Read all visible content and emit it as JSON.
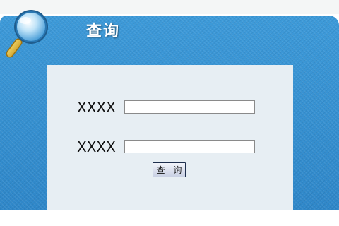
{
  "header": {
    "title": "查询",
    "icon": "magnifier-icon"
  },
  "form": {
    "fields": [
      {
        "label": "XXXX",
        "value": ""
      },
      {
        "label": "XXXX",
        "value": ""
      }
    ],
    "submit_label": "查 询"
  },
  "colors": {
    "panel": "#3b95d6",
    "form_background": "#e7eef3",
    "title_text": "#ffffff"
  }
}
